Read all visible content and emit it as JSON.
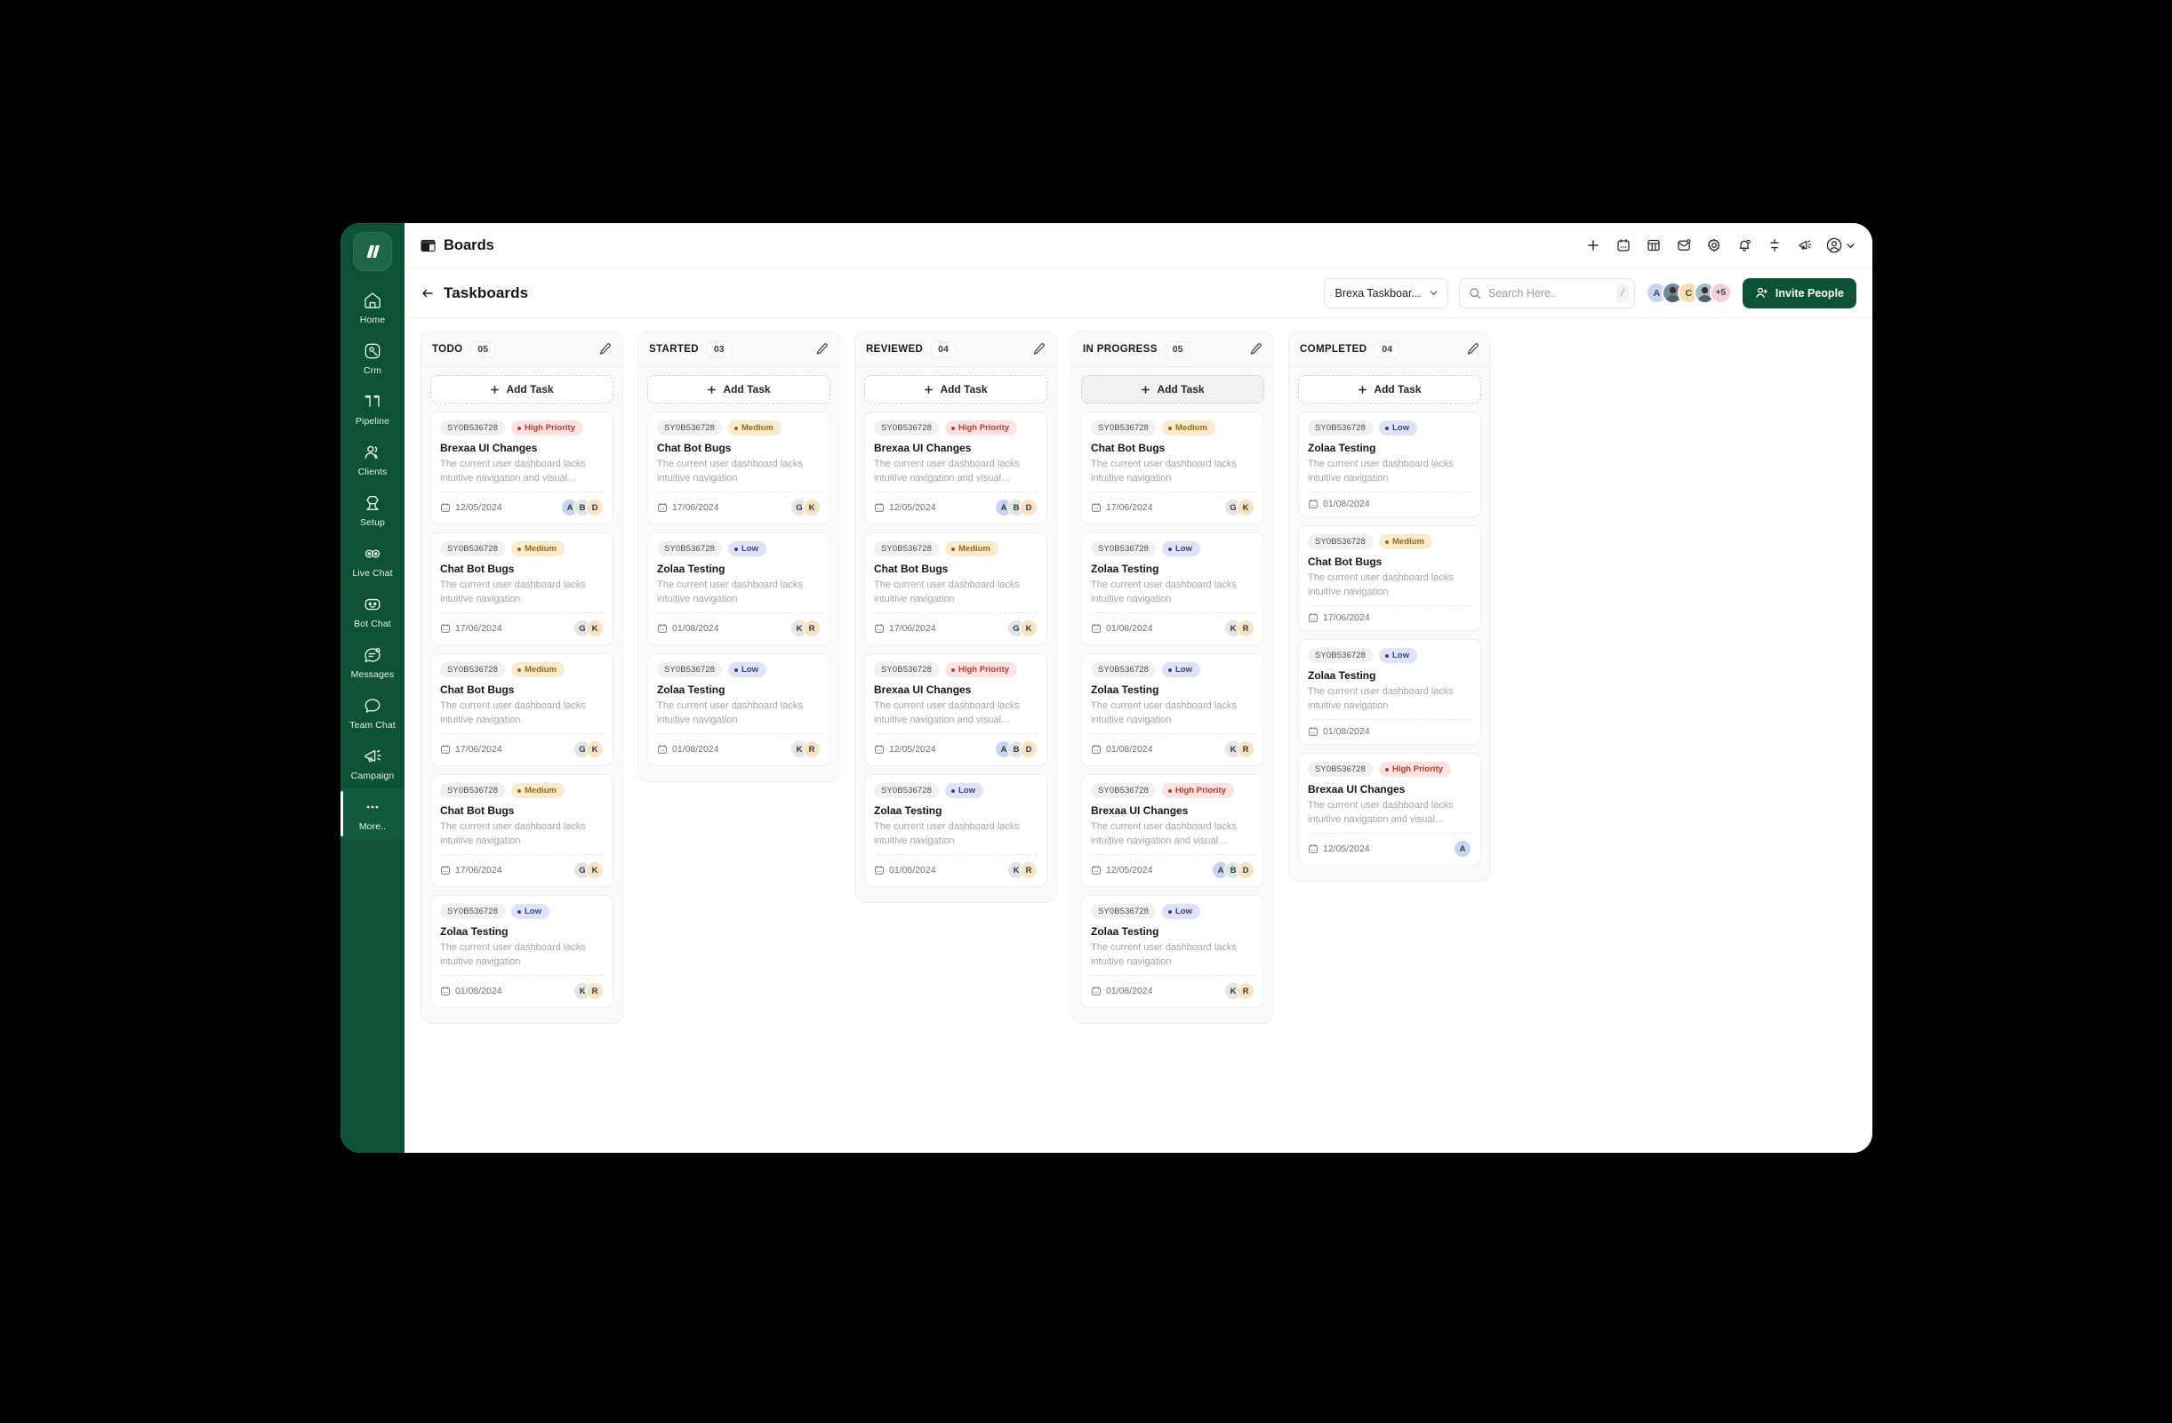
{
  "sidebar": {
    "brand": "brexa-logo",
    "items": [
      {
        "label": "Home",
        "icon": "home-icon",
        "active": false
      },
      {
        "label": "Crm",
        "icon": "crm-icon",
        "active": false
      },
      {
        "label": "Pipeline",
        "icon": "pipeline-icon",
        "active": false
      },
      {
        "label": "Clients",
        "icon": "clients-icon",
        "active": false
      },
      {
        "label": "Setup",
        "icon": "setup-icon",
        "active": false
      },
      {
        "label": "Live Chat",
        "icon": "live-chat-icon",
        "active": false
      },
      {
        "label": "Bot Chat",
        "icon": "bot-chat-icon",
        "active": false
      },
      {
        "label": "Messages",
        "icon": "messages-icon",
        "active": false
      },
      {
        "label": "Team Chat",
        "icon": "team-chat-icon",
        "active": false
      },
      {
        "label": "Campaign",
        "icon": "campaign-icon",
        "active": false
      },
      {
        "label": "More..",
        "icon": "more-dots-icon",
        "active": true
      }
    ]
  },
  "topbar": {
    "title": "Boards",
    "title_icon": "boards-icon",
    "actions": [
      {
        "name": "add-button",
        "icon": "plus-icon"
      },
      {
        "name": "calendar-button",
        "icon": "calendar-icon"
      },
      {
        "name": "table-button",
        "icon": "table-icon"
      },
      {
        "name": "mail-button",
        "icon": "mail-icon"
      },
      {
        "name": "settings-button",
        "icon": "gear-icon"
      },
      {
        "name": "notifications-button",
        "icon": "bell-icon"
      },
      {
        "name": "filter-button",
        "icon": "filter-icon"
      },
      {
        "name": "announcement-button",
        "icon": "megaphone-icon"
      }
    ],
    "profile_icon": "user-circle-icon",
    "profile_chevron": "chevron-down-icon"
  },
  "subheader": {
    "back_icon": "arrow-left-icon",
    "title": "Taskboards",
    "board_select": {
      "value": "Brexa Taskboar...",
      "chevron": "chevron-down-icon"
    },
    "search": {
      "placeholder": "Search Here..",
      "value": "",
      "icon": "search-icon",
      "shortcut": "/"
    },
    "avatars": [
      {
        "initial": "A",
        "bg": "#c8d4f2",
        "photo": false
      },
      {
        "initial": "",
        "bg": "#6e8a9b",
        "photo": true
      },
      {
        "initial": "C",
        "bg": "#fbdcae",
        "photo": false
      },
      {
        "initial": "",
        "bg": "#9fbcc9",
        "photo": true
      },
      {
        "initial": "+5",
        "bg": "#f6d0d4",
        "photo": false
      }
    ],
    "invite_label": "Invite People",
    "invite_icon": "user-plus-icon",
    "invite_color": "#0d5137"
  },
  "board": {
    "add_task_label": "Add Task",
    "add_task_icon": "plus-icon",
    "edit_icon": "pencil-icon",
    "date_icon": "calendar-icon",
    "columns": [
      {
        "title": "TODO",
        "count": "05",
        "add_hover": false,
        "cards": [
          {
            "id": "SY0B536728",
            "priority": "High Priority",
            "priority_class": "pri-high",
            "title": "Brexaa UI Changes",
            "desc": "The current user dashboard lacks intuitive navigation and visual hierarchy is not up to t...",
            "date": "12/05/2024",
            "avatars": [
              {
                "initial": "A",
                "bg": "#c8d4f2"
              },
              {
                "initial": "B",
                "bg": "#dfe5e0"
              },
              {
                "initial": "D",
                "bg": "#fbe2c3"
              }
            ]
          },
          {
            "id": "SY0B536728",
            "priority": "Medium",
            "priority_class": "pri-medium",
            "title": "Chat Bot Bugs",
            "desc": "The current user dashboard lacks intuitive navigation",
            "date": "17/06/2024",
            "avatars": [
              {
                "initial": "G",
                "bg": "#e4e4e4"
              },
              {
                "initial": "K",
                "bg": "#fbe2c3"
              }
            ]
          },
          {
            "id": "SY0B536728",
            "priority": "Medium",
            "priority_class": "pri-medium",
            "title": "Chat Bot Bugs",
            "desc": "The current user dashboard lacks intuitive navigation",
            "date": "17/06/2024",
            "avatars": [
              {
                "initial": "G",
                "bg": "#e4e4e4"
              },
              {
                "initial": "K",
                "bg": "#fbe2c3"
              }
            ]
          },
          {
            "id": "SY0B536728",
            "priority": "Medium",
            "priority_class": "pri-medium",
            "title": "Chat Bot Bugs",
            "desc": "The current user dashboard lacks intuitive navigation",
            "date": "17/06/2024",
            "avatars": [
              {
                "initial": "G",
                "bg": "#e4e4e4"
              },
              {
                "initial": "K",
                "bg": "#fbe2c3"
              }
            ]
          },
          {
            "id": "SY0B536728",
            "priority": "Low",
            "priority_class": "pri-low",
            "title": "Zolaa Testing",
            "desc": "The current user dashboard lacks intuitive navigation",
            "date": "01/08/2024",
            "avatars": [
              {
                "initial": "K",
                "bg": "#e4e4e4"
              },
              {
                "initial": "R",
                "bg": "#fbe2c3"
              }
            ]
          }
        ]
      },
      {
        "title": "STARTED",
        "count": "03",
        "add_hover": false,
        "cards": [
          {
            "id": "SY0B536728",
            "priority": "Medium",
            "priority_class": "pri-medium",
            "title": "Chat Bot Bugs",
            "desc": "The current user dashboard lacks intuitive navigation",
            "date": "17/06/2024",
            "avatars": [
              {
                "initial": "G",
                "bg": "#e4e4e4"
              },
              {
                "initial": "K",
                "bg": "#fbe2c3"
              }
            ]
          },
          {
            "id": "SY0B536728",
            "priority": "Low",
            "priority_class": "pri-low",
            "title": "Zolaa Testing",
            "desc": "The current user dashboard lacks intuitive navigation",
            "date": "01/08/2024",
            "avatars": [
              {
                "initial": "K",
                "bg": "#e4e4e4"
              },
              {
                "initial": "R",
                "bg": "#fbe2c3"
              }
            ]
          },
          {
            "id": "SY0B536728",
            "priority": "Low",
            "priority_class": "pri-low",
            "title": "Zolaa Testing",
            "desc": "The current user dashboard lacks intuitive navigation",
            "date": "01/08/2024",
            "avatars": [
              {
                "initial": "K",
                "bg": "#e4e4e4"
              },
              {
                "initial": "R",
                "bg": "#fbe2c3"
              }
            ]
          }
        ]
      },
      {
        "title": "REVIEWED",
        "count": "04",
        "add_hover": false,
        "cards": [
          {
            "id": "SY0B536728",
            "priority": "High Priority",
            "priority_class": "pri-high",
            "title": "Brexaa UI Changes",
            "desc": "The current user dashboard lacks intuitive navigation and visual hierarchy is not up to t...",
            "date": "12/05/2024",
            "avatars": [
              {
                "initial": "A",
                "bg": "#c8d4f2"
              },
              {
                "initial": "B",
                "bg": "#dfe5e0"
              },
              {
                "initial": "D",
                "bg": "#fbe2c3"
              }
            ]
          },
          {
            "id": "SY0B536728",
            "priority": "Medium",
            "priority_class": "pri-medium",
            "title": "Chat Bot Bugs",
            "desc": "The current user dashboard lacks intuitive navigation",
            "date": "17/06/2024",
            "avatars": [
              {
                "initial": "G",
                "bg": "#e4e4e4"
              },
              {
                "initial": "K",
                "bg": "#fbe2c3"
              }
            ]
          },
          {
            "id": "SY0B536728",
            "priority": "High Priority",
            "priority_class": "pri-high",
            "title": "Brexaa UI Changes",
            "desc": "The current user dashboard lacks intuitive navigation and visual hierarchy is not up to t...",
            "date": "12/05/2024",
            "avatars": [
              {
                "initial": "A",
                "bg": "#c8d4f2"
              },
              {
                "initial": "B",
                "bg": "#dfe5e0"
              },
              {
                "initial": "D",
                "bg": "#fbe2c3"
              }
            ]
          },
          {
            "id": "SY0B536728",
            "priority": "Low",
            "priority_class": "pri-low",
            "title": "Zolaa Testing",
            "desc": "The current user dashboard lacks intuitive navigation",
            "date": "01/08/2024",
            "avatars": [
              {
                "initial": "K",
                "bg": "#e4e4e4"
              },
              {
                "initial": "R",
                "bg": "#fbe2c3"
              }
            ]
          }
        ]
      },
      {
        "title": "IN PROGRESS",
        "count": "05",
        "add_hover": true,
        "cards": [
          {
            "id": "SY0B536728",
            "priority": "Medium",
            "priority_class": "pri-medium",
            "title": "Chat Bot Bugs",
            "desc": "The current user dashboard lacks intuitive navigation",
            "date": "17/06/2024",
            "avatars": [
              {
                "initial": "G",
                "bg": "#e4e4e4"
              },
              {
                "initial": "K",
                "bg": "#fbe2c3"
              }
            ]
          },
          {
            "id": "SY0B536728",
            "priority": "Low",
            "priority_class": "pri-low",
            "title": "Zolaa Testing",
            "desc": "The current user dashboard lacks intuitive navigation",
            "date": "01/08/2024",
            "avatars": [
              {
                "initial": "K",
                "bg": "#e4e4e4"
              },
              {
                "initial": "R",
                "bg": "#fbe2c3"
              }
            ]
          },
          {
            "id": "SY0B536728",
            "priority": "Low",
            "priority_class": "pri-low",
            "title": "Zolaa Testing",
            "desc": "The current user dashboard lacks intuitive navigation",
            "date": "01/08/2024",
            "avatars": [
              {
                "initial": "K",
                "bg": "#e4e4e4"
              },
              {
                "initial": "R",
                "bg": "#fbe2c3"
              }
            ]
          },
          {
            "id": "SY0B536728",
            "priority": "High Priority",
            "priority_class": "pri-high",
            "title": "Brexaa UI Changes",
            "desc": "The current user dashboard lacks intuitive navigation and visual hierarchy is not up to t...",
            "date": "12/05/2024",
            "avatars": [
              {
                "initial": "A",
                "bg": "#c8d4f2"
              },
              {
                "initial": "B",
                "bg": "#dfe5e0"
              },
              {
                "initial": "D",
                "bg": "#fbe2c3"
              }
            ]
          },
          {
            "id": "SY0B536728",
            "priority": "Low",
            "priority_class": "pri-low",
            "title": "Zolaa Testing",
            "desc": "The current user dashboard lacks intuitive navigation",
            "date": "01/08/2024",
            "avatars": [
              {
                "initial": "K",
                "bg": "#e4e4e4"
              },
              {
                "initial": "R",
                "bg": "#fbe2c3"
              }
            ]
          }
        ]
      },
      {
        "title": "COMPLETED",
        "count": "04",
        "add_hover": false,
        "cards": [
          {
            "id": "SY0B536728",
            "priority": "Low",
            "priority_class": "pri-low",
            "title": "Zolaa Testing",
            "desc": "The current user dashboard lacks intuitive navigation",
            "date": "01/08/2024",
            "avatars": []
          },
          {
            "id": "SY0B536728",
            "priority": "Medium",
            "priority_class": "pri-medium",
            "title": "Chat Bot Bugs",
            "desc": "The current user dashboard lacks intuitive navigation",
            "date": "17/06/2024",
            "avatars": []
          },
          {
            "id": "SY0B536728",
            "priority": "Low",
            "priority_class": "pri-low",
            "title": "Zolaa Testing",
            "desc": "The current user dashboard lacks intuitive navigation",
            "date": "01/08/2024",
            "avatars": []
          },
          {
            "id": "SY0B536728",
            "priority": "High Priority",
            "priority_class": "pri-high",
            "title": "Brexaa UI Changes",
            "desc": "The current user dashboard lacks intuitive navigation and visual hierarchy is not up to t...",
            "date": "12/05/2024",
            "avatars": [
              {
                "initial": "A",
                "bg": "#c8d4f2"
              }
            ]
          }
        ]
      }
    ]
  }
}
